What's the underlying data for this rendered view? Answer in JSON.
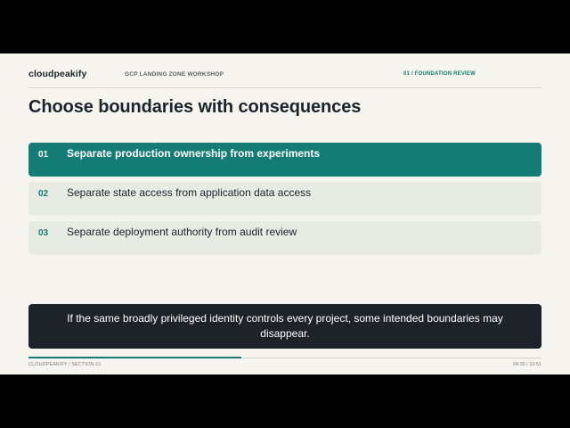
{
  "header": {
    "brand": "cloudpeakify",
    "workshop": "GCP LANDING ZONE WORKSHOP",
    "section_tag": "01 / FOUNDATION REVIEW"
  },
  "title": "Choose boundaries with consequences",
  "items": [
    {
      "number": "01",
      "label": "Separate production ownership from experiments",
      "active": true
    },
    {
      "number": "02",
      "label": "Separate state access from application data access",
      "active": false
    },
    {
      "number": "03",
      "label": "Separate deployment authority from audit review",
      "active": false
    }
  ],
  "caption": "If the same broadly privileged identity controls every project, some intended boundaries may disappear.",
  "footer": {
    "left": "CLOUDPEAKIFY / SECTION 01",
    "time": "04:30 / 10:51"
  },
  "progress": {
    "fraction": 0.415
  },
  "colors": {
    "accent": "#147c74",
    "item_bg": "#e7ebe4",
    "slide_bg": "#f6f4ee",
    "caption_bg": "#1d2329"
  }
}
